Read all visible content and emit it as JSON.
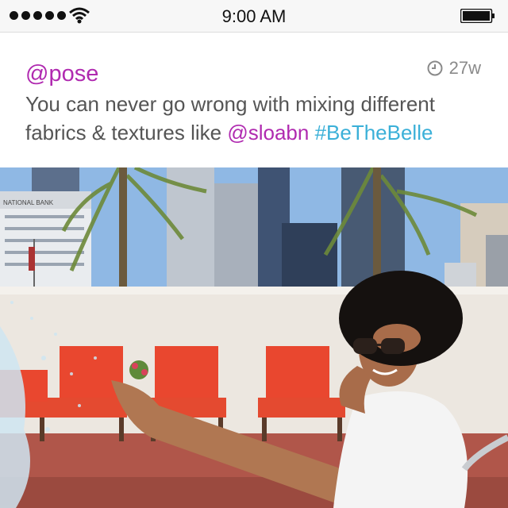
{
  "status_bar": {
    "time": "9:00 AM",
    "icons": [
      "signal-dots-icon",
      "wifi-icon",
      "battery-icon"
    ]
  },
  "post": {
    "username": "@pose",
    "timestamp": "27w",
    "timestamp_icon": "clock-icon",
    "text_before": "You can never go wrong with mixing different fabrics & textures like ",
    "mention": "@sloabn",
    "hashtag": "#BeTheBelle",
    "colors": {
      "username": "#b02ab0",
      "hashtag": "#3bb0d8",
      "text": "#555555"
    }
  },
  "photo": {
    "building_sign": "NATIONAL BANK"
  }
}
